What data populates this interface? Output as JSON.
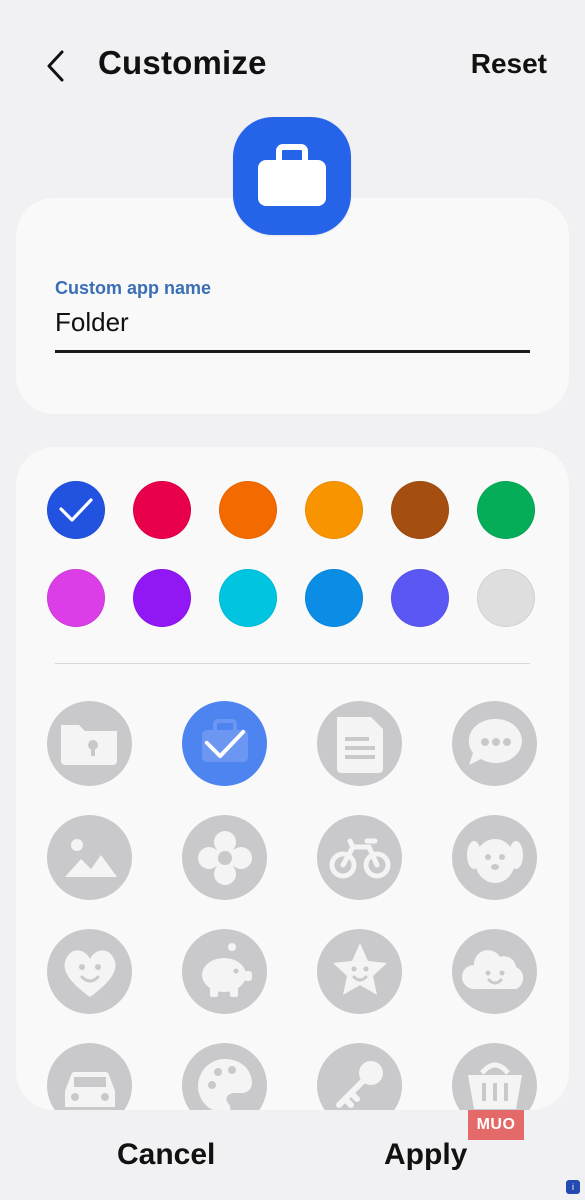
{
  "header": {
    "title": "Customize",
    "reset_label": "Reset"
  },
  "app_icon": {
    "icon": "briefcase-icon",
    "color": "#2563e8"
  },
  "name_field": {
    "label": "Custom app name",
    "value": "Folder"
  },
  "colors": [
    {
      "name": "blue",
      "hex": "#2252e0",
      "selected": true
    },
    {
      "name": "red",
      "hex": "#e8004a",
      "selected": false
    },
    {
      "name": "dark-orange",
      "hex": "#f26a00",
      "selected": false
    },
    {
      "name": "orange",
      "hex": "#f89400",
      "selected": false
    },
    {
      "name": "brown",
      "hex": "#a44f10",
      "selected": false
    },
    {
      "name": "green",
      "hex": "#06ad58",
      "selected": false
    },
    {
      "name": "magenta",
      "hex": "#db3ee6",
      "selected": false
    },
    {
      "name": "purple",
      "hex": "#9217f5",
      "selected": false
    },
    {
      "name": "cyan",
      "hex": "#00c4e0",
      "selected": false
    },
    {
      "name": "sky-blue",
      "hex": "#0b8de6",
      "selected": false
    },
    {
      "name": "indigo",
      "hex": "#5b57f5",
      "selected": false
    },
    {
      "name": "light-gray",
      "hex": "#dedede",
      "selected": false
    }
  ],
  "icons": [
    {
      "name": "folder-lock-icon",
      "selected": false
    },
    {
      "name": "briefcase-icon",
      "selected": true
    },
    {
      "name": "document-icon",
      "selected": false
    },
    {
      "name": "chat-bubble-icon",
      "selected": false
    },
    {
      "name": "image-icon",
      "selected": false
    },
    {
      "name": "flower-icon",
      "selected": false
    },
    {
      "name": "bicycle-icon",
      "selected": false
    },
    {
      "name": "dog-icon",
      "selected": false
    },
    {
      "name": "heart-face-icon",
      "selected": false
    },
    {
      "name": "piggy-bank-icon",
      "selected": false
    },
    {
      "name": "star-face-icon",
      "selected": false
    },
    {
      "name": "cloud-face-icon",
      "selected": false
    },
    {
      "name": "car-icon",
      "selected": false
    },
    {
      "name": "palette-icon",
      "selected": false
    },
    {
      "name": "key-icon",
      "selected": false
    },
    {
      "name": "basket-icon",
      "selected": false
    }
  ],
  "footer": {
    "cancel_label": "Cancel",
    "apply_label": "Apply"
  },
  "watermark": {
    "text": "MUO"
  }
}
